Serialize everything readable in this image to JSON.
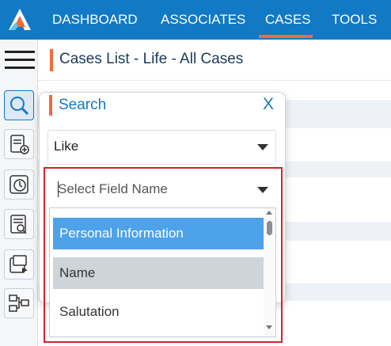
{
  "nav": {
    "items": [
      {
        "label": "DASHBOARD"
      },
      {
        "label": "ASSOCIATES"
      },
      {
        "label": "CASES"
      },
      {
        "label": "TOOLS"
      }
    ],
    "active": "CASES",
    "accent_color": "#f26b3a",
    "bar_color": "#1279c4"
  },
  "rail": {
    "icons": [
      "search-icon",
      "add-document-icon",
      "history-icon",
      "document-search-icon",
      "export-icon",
      "workflow-icon"
    ]
  },
  "page": {
    "title": "Cases List - Life - All Cases"
  },
  "search_panel": {
    "title": "Search",
    "close_label": "X",
    "operator_value": "Like",
    "field_placeholder": "Select Field Name",
    "options": [
      {
        "label": "Personal Information",
        "state": "selected"
      },
      {
        "label": "Name",
        "state": "hover"
      },
      {
        "label": "Salutation",
        "state": "normal"
      }
    ]
  }
}
